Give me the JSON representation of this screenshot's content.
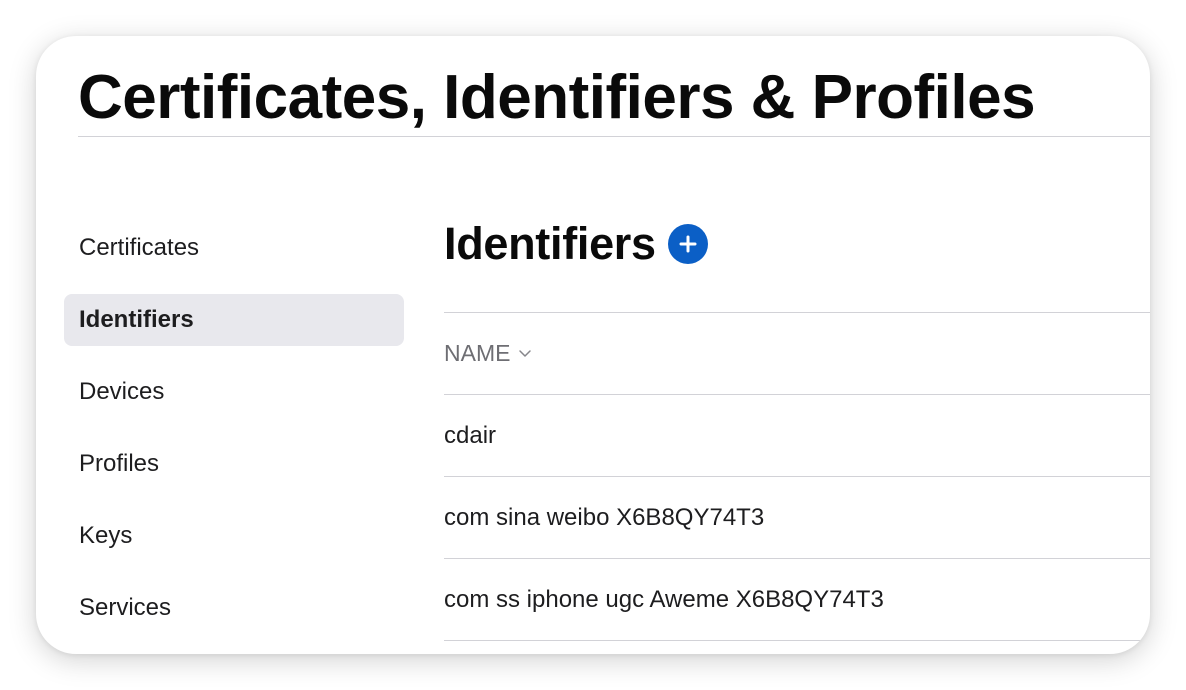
{
  "page": {
    "title": "Certificates, Identifiers & Profiles"
  },
  "sidebar": {
    "items": [
      {
        "label": "Certificates",
        "active": false
      },
      {
        "label": "Identifiers",
        "active": true
      },
      {
        "label": "Devices",
        "active": false
      },
      {
        "label": "Profiles",
        "active": false
      },
      {
        "label": "Keys",
        "active": false
      },
      {
        "label": "Services",
        "active": false
      }
    ]
  },
  "main": {
    "section_title": "Identifiers",
    "add_icon": "plus-circle-icon",
    "table": {
      "column_header": "NAME",
      "sort_icon": "chevron-down-icon",
      "rows": [
        {
          "name": "cdair"
        },
        {
          "name": "com sina weibo X6B8QY74T3"
        },
        {
          "name": "com ss iphone ugc Aweme X6B8QY74T3"
        }
      ]
    }
  },
  "colors": {
    "accent": "#0b5fc6",
    "active_item_bg": "#e8e8ed",
    "divider": "#d2d2d7",
    "header_text": "#6e6e73"
  }
}
